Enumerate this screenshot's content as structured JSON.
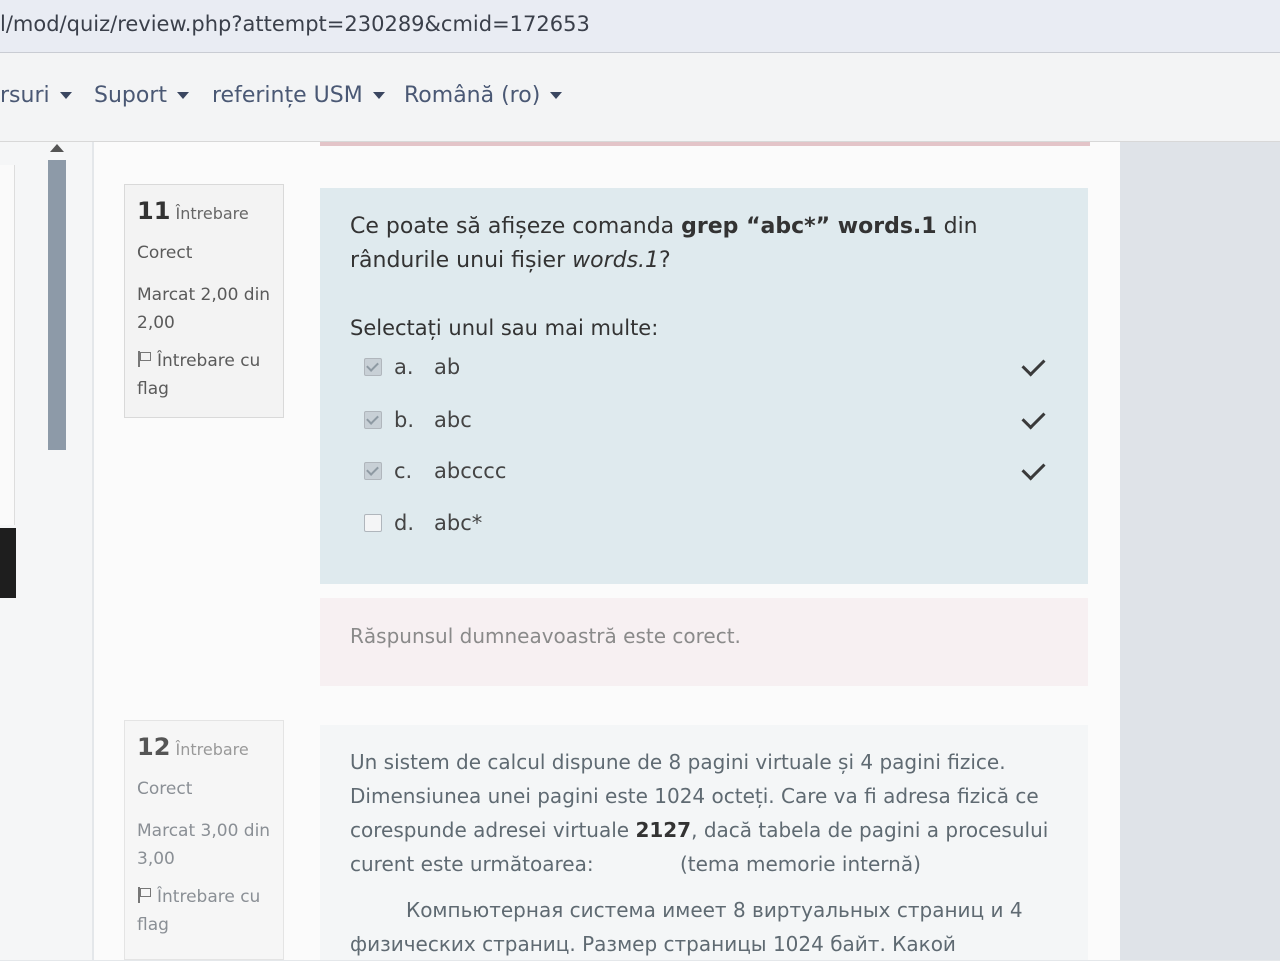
{
  "browser": {
    "url": "l/mod/quiz/review.php?attempt=230289&cmid=172653"
  },
  "nav": {
    "items": [
      {
        "label": "rsuri"
      },
      {
        "label": "Suport"
      },
      {
        "label": "referințe USM"
      },
      {
        "label": "Română (ro)"
      }
    ]
  },
  "q11": {
    "number": "11",
    "word": "Întrebare",
    "status": "Corect",
    "mark": "Marcat 2,00 din 2,00",
    "flag": "Întrebare cu flag",
    "text_pre": "Ce poate să afișeze comanda ",
    "text_bold": "grep “abc*” words.1",
    "text_mid": " din rândurile unui fișier ",
    "text_italic": "words.1",
    "text_end": "?",
    "prompt": "Selectați unul sau mai multe:",
    "answers": [
      {
        "letter": "a.",
        "text": "ab",
        "checked": true,
        "correct": true
      },
      {
        "letter": "b.",
        "text": "abc",
        "checked": true,
        "correct": true
      },
      {
        "letter": "c.",
        "text": "abcccc",
        "checked": true,
        "correct": true
      },
      {
        "letter": "d.",
        "text": "abc*",
        "checked": false,
        "correct": false
      }
    ],
    "feedback": "Răspunsul dumneavoastră este corect."
  },
  "q12": {
    "number": "12",
    "word": "Întrebare",
    "status": "Corect",
    "mark": "Marcat 3,00 din 3,00",
    "flag": "Întrebare cu flag",
    "text_pre": "Un sistem de calcul dispune de 8 pagini virtuale și 4 pagini fizice. Dimensiunea unei pagini este 1024 octeți. Care va fi adresa fizică ce corespunde adresei virtuale ",
    "text_bold": "2127",
    "text_post": ", dacă tabela de pagini a procesului curent este următoarea:",
    "topic": "(tema memorie internă)",
    "text_ru": "Компьютерная система имеет 8 виртуальных страниц и 4 физических страниц. Размер страницы 1024 байт. Какой"
  },
  "colors": {
    "question_bg": "#dfeaee",
    "feedback_bg": "#f7f0f2",
    "link": "#4a5874"
  }
}
